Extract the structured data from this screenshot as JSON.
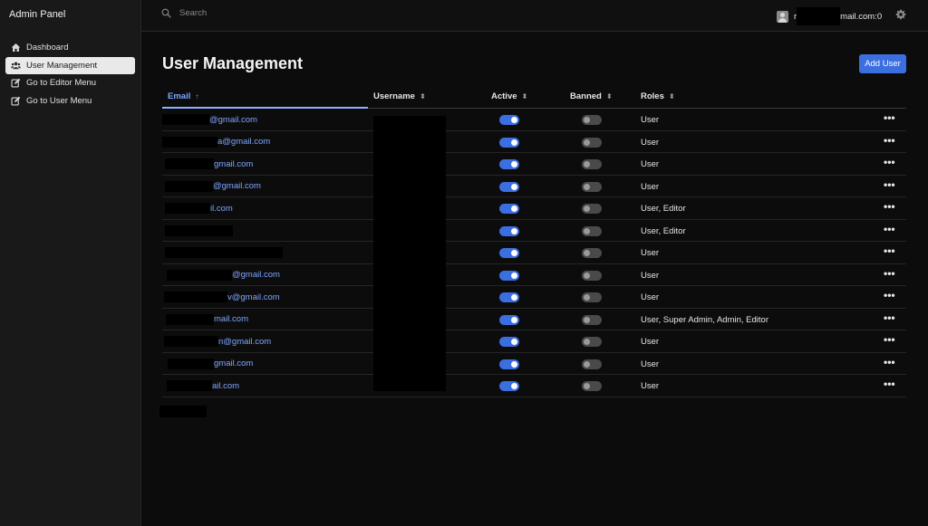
{
  "app": {
    "title": "Admin Panel"
  },
  "sidebar": {
    "items": [
      {
        "label": "Dashboard",
        "icon": "home-icon",
        "active": false
      },
      {
        "label": "User Management",
        "icon": "users-icon",
        "active": true
      },
      {
        "label": "Go to Editor Menu",
        "icon": "edit-icon",
        "active": false
      },
      {
        "label": "Go to User Menu",
        "icon": "edit-icon",
        "active": false
      }
    ]
  },
  "topbar": {
    "search_placeholder": "Search",
    "user_email_prefix": "r",
    "user_email_suffix": "mail.com:0"
  },
  "main": {
    "title": "User Management",
    "add_button": "Add User"
  },
  "table": {
    "columns": [
      "Email",
      "Username",
      "Active",
      "Banned",
      "Roles"
    ],
    "sort_email": "↑",
    "sort_other": "⬍",
    "rows": [
      {
        "email_visible": "@gmail.com",
        "active": true,
        "banned": false,
        "roles": "User"
      },
      {
        "email_visible": "a@gmail.com",
        "active": true,
        "banned": false,
        "roles": "User"
      },
      {
        "email_visible": "gmail.com",
        "active": true,
        "banned": false,
        "roles": "User"
      },
      {
        "email_visible": "@gmail.com",
        "active": true,
        "banned": false,
        "roles": "User"
      },
      {
        "email_visible": "il.com",
        "active": true,
        "banned": false,
        "roles": "User, Editor"
      },
      {
        "email_visible": "",
        "active": true,
        "banned": false,
        "roles": "User, Editor"
      },
      {
        "email_visible": "",
        "active": true,
        "banned": false,
        "roles": "User"
      },
      {
        "email_visible": "@gmail.com",
        "active": true,
        "banned": false,
        "roles": "User"
      },
      {
        "email_visible": "v@gmail.com",
        "active": true,
        "banned": false,
        "roles": "User"
      },
      {
        "email_visible": "mail.com",
        "active": true,
        "banned": false,
        "roles": "User, Super Admin, Admin, Editor"
      },
      {
        "email_visible": "n@gmail.com",
        "active": true,
        "banned": false,
        "roles": "User"
      },
      {
        "email_visible": "gmail.com",
        "active": true,
        "banned": false,
        "roles": "User"
      },
      {
        "email_visible": "ail.com",
        "active": true,
        "banned": false,
        "roles": "User"
      }
    ],
    "more_label": "•••"
  },
  "colors": {
    "accent": "#3b6fe0",
    "link": "#7ea6ff",
    "background": "#0c0c0d",
    "sidebar": "#191919"
  }
}
